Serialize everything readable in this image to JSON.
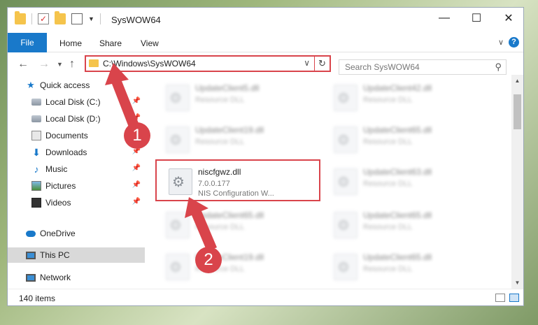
{
  "window": {
    "title": "SysWOW64",
    "controls": {
      "minimize": "—",
      "maximize": "☐",
      "close": "✕"
    }
  },
  "ribbon": {
    "tabs": [
      "File",
      "Home",
      "Share",
      "View"
    ]
  },
  "navigation": {
    "address": "C:\\Windows\\SysWOW64",
    "search_placeholder": "Search SysWOW64"
  },
  "sidebar": {
    "items": [
      {
        "label": "Quick access",
        "icon": "star-icon",
        "pinned": false
      },
      {
        "label": "Local Disk (C:)",
        "icon": "disk-icon",
        "pinned": true
      },
      {
        "label": "Local Disk (D:)",
        "icon": "disk-icon",
        "pinned": true
      },
      {
        "label": "Documents",
        "icon": "document-icon",
        "pinned": true
      },
      {
        "label": "Downloads",
        "icon": "download-icon",
        "pinned": true
      },
      {
        "label": "Music",
        "icon": "music-icon",
        "pinned": true
      },
      {
        "label": "Pictures",
        "icon": "picture-icon",
        "pinned": true
      },
      {
        "label": "Videos",
        "icon": "video-icon",
        "pinned": true
      },
      {
        "label": "OneDrive",
        "icon": "cloud-icon",
        "pinned": false
      },
      {
        "label": "This PC",
        "icon": "computer-icon",
        "pinned": false,
        "selected": true
      },
      {
        "label": "Network",
        "icon": "network-icon",
        "pinned": false
      }
    ]
  },
  "files": {
    "left_column": [
      {
        "name": "UpdateClient5.dll",
        "version": "Resource DLL",
        "description": ""
      },
      {
        "name": "UpdateClient19.dll",
        "version": "Resource DLL",
        "description": ""
      },
      {
        "name": "niscfgwz.dll",
        "version": "7.0.0.177",
        "description": "NIS Configuration W...",
        "highlighted": true
      },
      {
        "name": "UpdateClient65.dll",
        "version": "Resource DLL",
        "description": ""
      },
      {
        "name": "UpdateClient19.dll",
        "version": "Resource DLL",
        "description": ""
      }
    ],
    "right_column": [
      {
        "name": "UpdateClient42.dll",
        "version": "Resource DLL",
        "description": ""
      },
      {
        "name": "UpdateClient65.dll",
        "version": "Resource DLL",
        "description": ""
      },
      {
        "name": "UpdateClient63.dll",
        "version": "Resource DLL",
        "description": ""
      },
      {
        "name": "UpdateClient65.dll",
        "version": "Resource DLL",
        "description": ""
      },
      {
        "name": "UpdateClient65.dll",
        "version": "Resource DLL",
        "description": ""
      }
    ]
  },
  "status": {
    "item_count": "140 items"
  },
  "annotations": {
    "step1": "1",
    "step2": "2",
    "accent_color": "#d9444b"
  },
  "colors": {
    "file_tab": "#1979ca",
    "highlight": "#d9444b"
  }
}
